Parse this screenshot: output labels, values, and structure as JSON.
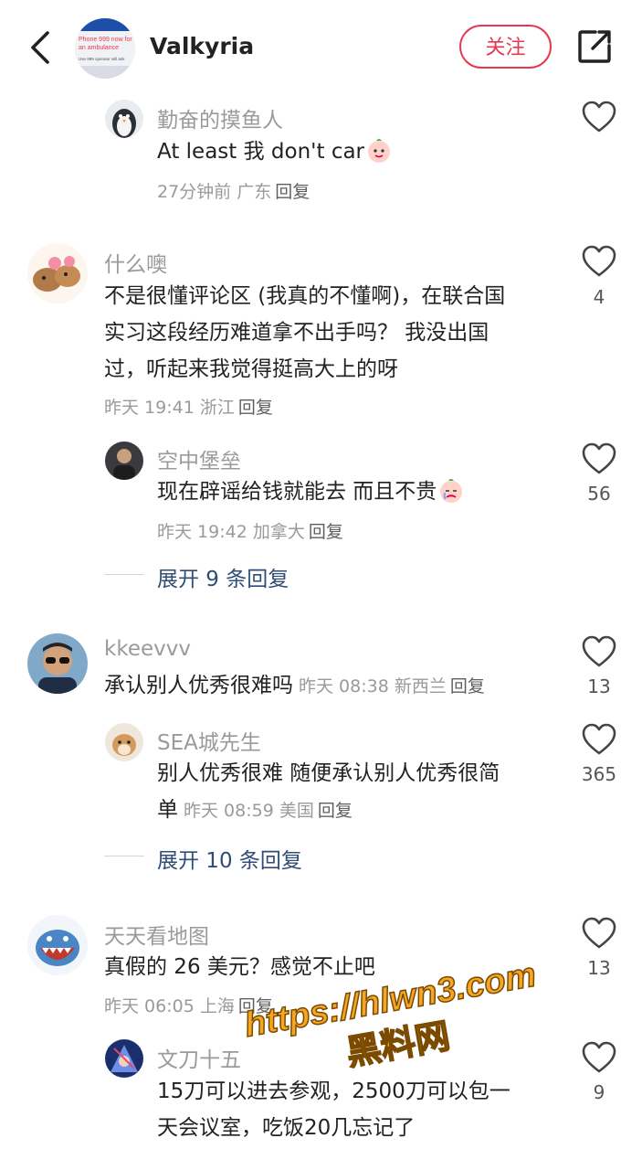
{
  "header": {
    "name": "Valkyria",
    "follow_label": "关注",
    "avatar_text": [
      "Phone 999 now for",
      "an ambulance",
      "Use 999 operator will ask"
    ]
  },
  "comments": [
    {
      "author": "勤奋的摸鱼人",
      "text": "At least 我 don't car",
      "time": "27分钟前",
      "location": "广东",
      "reply_label": "回复",
      "likes": ""
    },
    {
      "author": "什么噢",
      "text_lines": [
        "不是很懂评论区 (我真的不懂啊)，在联合国",
        "实习这段经历难道拿不出手吗？ 我没出国",
        "过，听起来我觉得挺高大上的呀"
      ],
      "time": "昨天 19:41",
      "location": "浙江",
      "reply_label": "回复",
      "likes": "4"
    },
    {
      "author": "空中堡垒",
      "text": "现在辟谣给钱就能去 而且不贵",
      "time": "昨天 19:42",
      "location": "加拿大",
      "reply_label": "回复",
      "likes": "56"
    },
    {
      "author": "kkeevvv",
      "text": "承认别人优秀很难吗",
      "time": "昨天 08:38",
      "location": "新西兰",
      "reply_label": "回复",
      "likes": "13"
    },
    {
      "author": "SEA城先生",
      "text_lines": [
        "别人优秀很难 随便承认别人优秀很简",
        "单"
      ],
      "time": "昨天 08:59",
      "location": "美国",
      "reply_label": "回复",
      "likes": "365"
    },
    {
      "author": "天天看地图",
      "text": "真假的 26 美元？感觉不止吧",
      "time": "昨天 06:05",
      "location": "上海",
      "reply_label": "回复",
      "likes": "13"
    },
    {
      "author": "文刀十五",
      "text_lines": [
        "15刀可以进去参观，2500刀可以包一",
        "天会议室，吃饭20几忘记了"
      ],
      "likes": "9"
    }
  ],
  "expand": [
    "展开 9 条回复",
    "展开 10 条回复"
  ],
  "watermark": {
    "line1": "https://hlwn3.com",
    "line2": "黑料网"
  },
  "colors": {
    "follow": "#e8384f",
    "expand_link": "#2f4d75",
    "secondary_text": "#9a9a9a"
  }
}
